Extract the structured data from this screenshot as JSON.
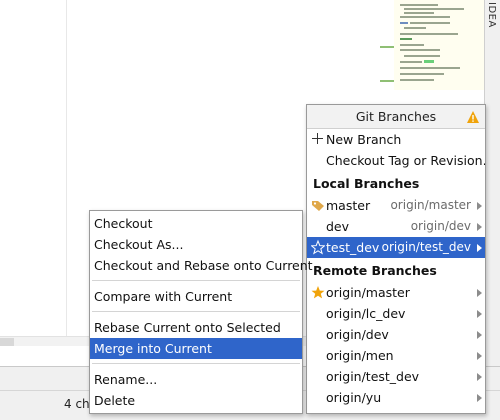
{
  "side_tab": {
    "label": "IDEA"
  },
  "status_bar": {
    "text": "4 cha"
  },
  "git_branches": {
    "title": "Git Branches",
    "warning_icon": "warning-icon",
    "actions": [
      {
        "label": "New Branch",
        "icon": "plus-icon"
      },
      {
        "label": "Checkout Tag or Revision..."
      }
    ],
    "local_header": "Local Branches",
    "local": [
      {
        "name": "master",
        "tracking": "origin/master",
        "icon": "tag-icon",
        "selected": false
      },
      {
        "name": "dev",
        "tracking": "origin/dev",
        "icon": "",
        "selected": false
      },
      {
        "name": "test_dev",
        "tracking": "origin/test_dev",
        "icon": "star-outline-icon",
        "selected": true
      }
    ],
    "remote_header": "Remote Branches",
    "remote": [
      {
        "name": "origin/master",
        "icon": "star-icon"
      },
      {
        "name": "origin/lc_dev"
      },
      {
        "name": "origin/dev"
      },
      {
        "name": "origin/men"
      },
      {
        "name": "origin/test_dev"
      },
      {
        "name": "origin/yu"
      }
    ]
  },
  "context_menu": {
    "groups": [
      [
        "Checkout",
        "Checkout As...",
        "Checkout and Rebase onto Current"
      ],
      [
        "Compare with Current"
      ],
      [
        "Rebase Current onto Selected",
        "Merge into Current"
      ],
      [
        "Rename...",
        "Delete"
      ]
    ],
    "selected": "Merge into Current"
  },
  "colors": {
    "selection": "#2f65ca",
    "warning": "#f0a30a",
    "tag": "#e0a84a",
    "star": "#f0a30a"
  }
}
